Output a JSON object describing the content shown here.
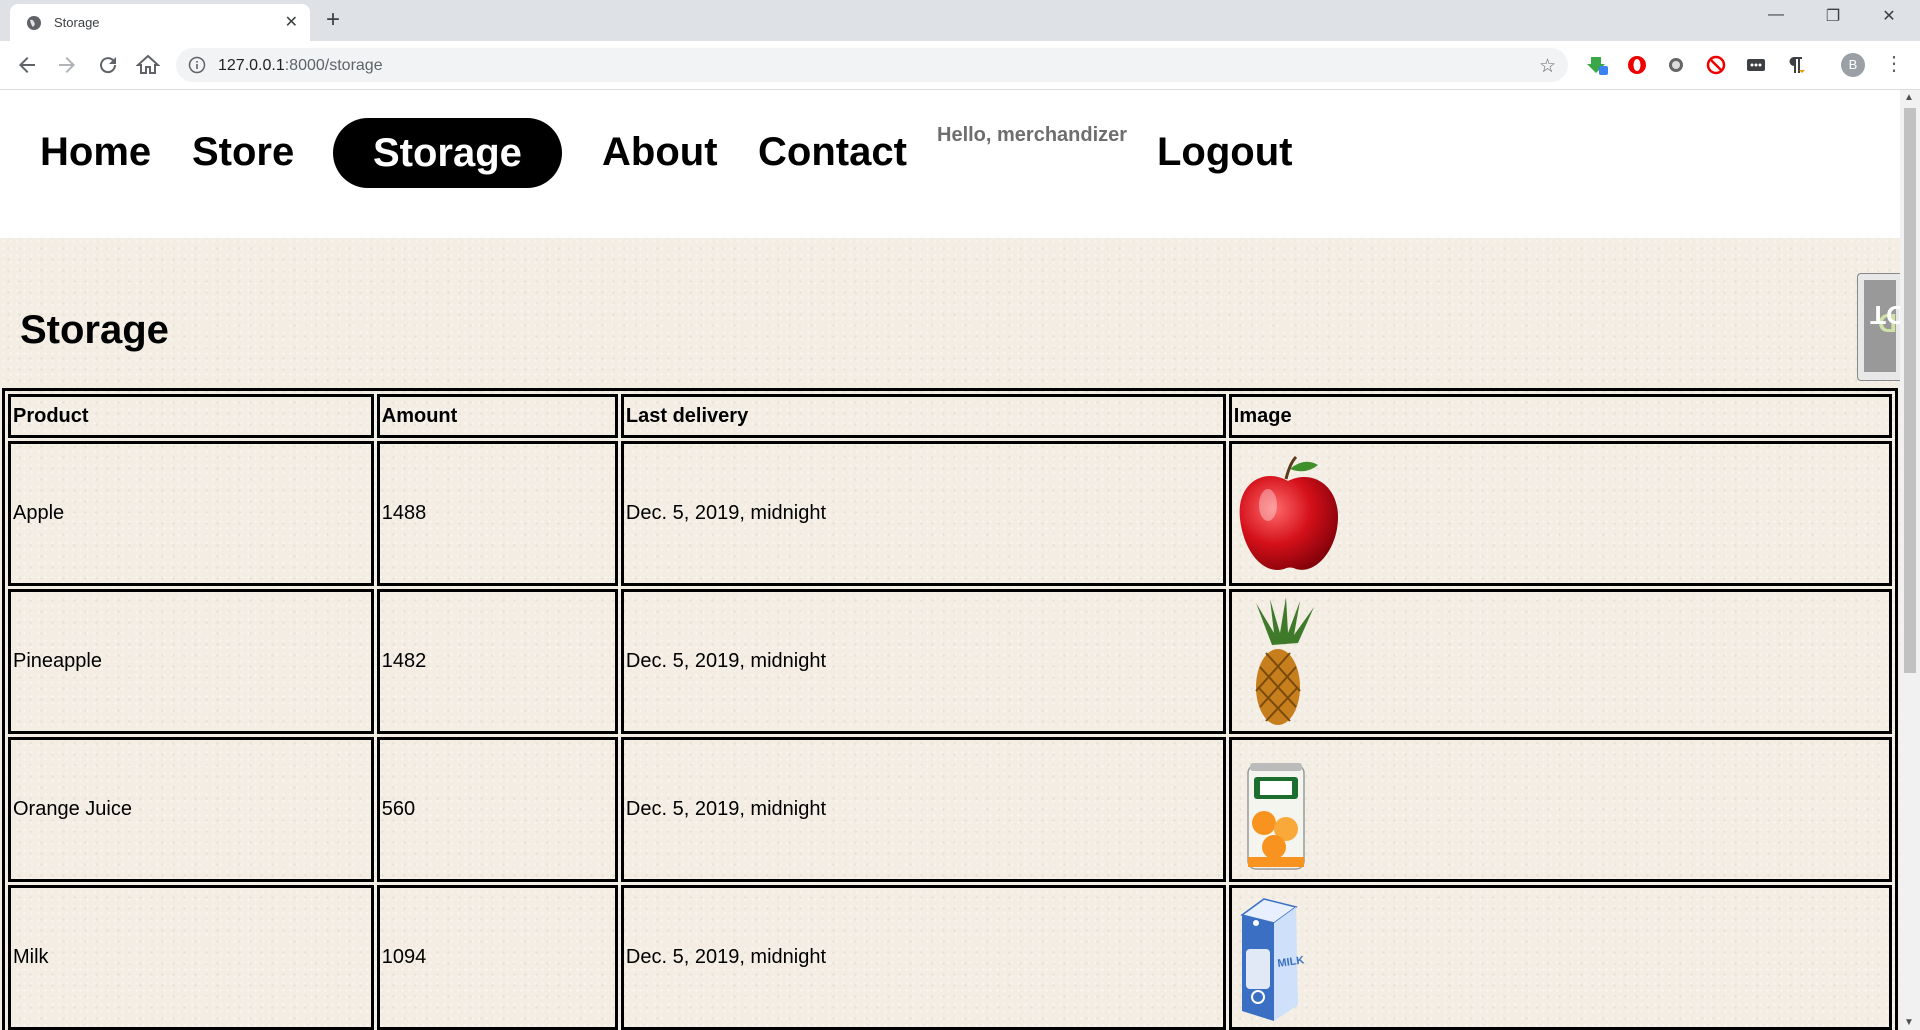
{
  "browser": {
    "tab_title": "Storage",
    "url_host": "127.0.0.1",
    "url_rest": ":8000/storage",
    "profile_initial": "B"
  },
  "nav": {
    "home": "Home",
    "store": "Store",
    "storage": "Storage",
    "about": "About",
    "contact": "Contact",
    "greeting": "Hello, merchandizer",
    "logout": "Logout"
  },
  "page": {
    "title": "Storage"
  },
  "table": {
    "headers": [
      "Product",
      "Amount",
      "Last delivery",
      "Image"
    ],
    "rows": [
      {
        "product": "Apple",
        "amount": "1488",
        "last_delivery": "Dec. 5, 2019, midnight",
        "image": "apple-image"
      },
      {
        "product": "Pineapple",
        "amount": "1482",
        "last_delivery": "Dec. 5, 2019, midnight",
        "image": "pineapple-image"
      },
      {
        "product": "Orange Juice",
        "amount": "560",
        "last_delivery": "Dec. 5, 2019, midnight",
        "image": "orange-juice-image"
      },
      {
        "product": "Milk",
        "amount": "1094",
        "last_delivery": "Dec. 5, 2019, midnight",
        "image": "milk-carton-image"
      }
    ]
  },
  "ddt": {
    "d": "D",
    "label": "DT"
  },
  "colors": {
    "content_bg": "#f3ede4",
    "active_nav_bg": "#000000",
    "greeting": "#6e6e6e"
  }
}
